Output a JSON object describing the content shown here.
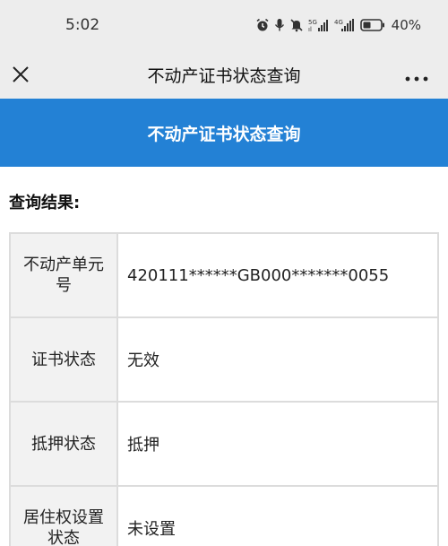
{
  "status_bar": {
    "time": "5:02",
    "network_5g": "5G",
    "network_4g": "4G",
    "battery": "40%"
  },
  "nav": {
    "title": "不动产证书状态查询"
  },
  "banner": {
    "title": "不动产证书状态查询"
  },
  "section": {
    "title": "查询结果:"
  },
  "table": {
    "rows": [
      {
        "label": "不动产单元号",
        "value": "420111******GB000*******0055"
      },
      {
        "label": "证书状态",
        "value": "无效"
      },
      {
        "label": "抵押状态",
        "value": "抵押"
      },
      {
        "label": "居住权设置状态",
        "value": "未设置"
      }
    ]
  },
  "colors": {
    "accent": "#2381d5",
    "header_bg": "#ededed",
    "label_bg": "#f2f2f2",
    "border": "#dcdcdc"
  },
  "icons": {
    "close": "close-icon",
    "more": "more-icon",
    "alarm": "alarm-icon",
    "mic": "mic-icon",
    "mute": "bell-off-icon",
    "signal": "signal-icon",
    "battery": "battery-icon"
  }
}
